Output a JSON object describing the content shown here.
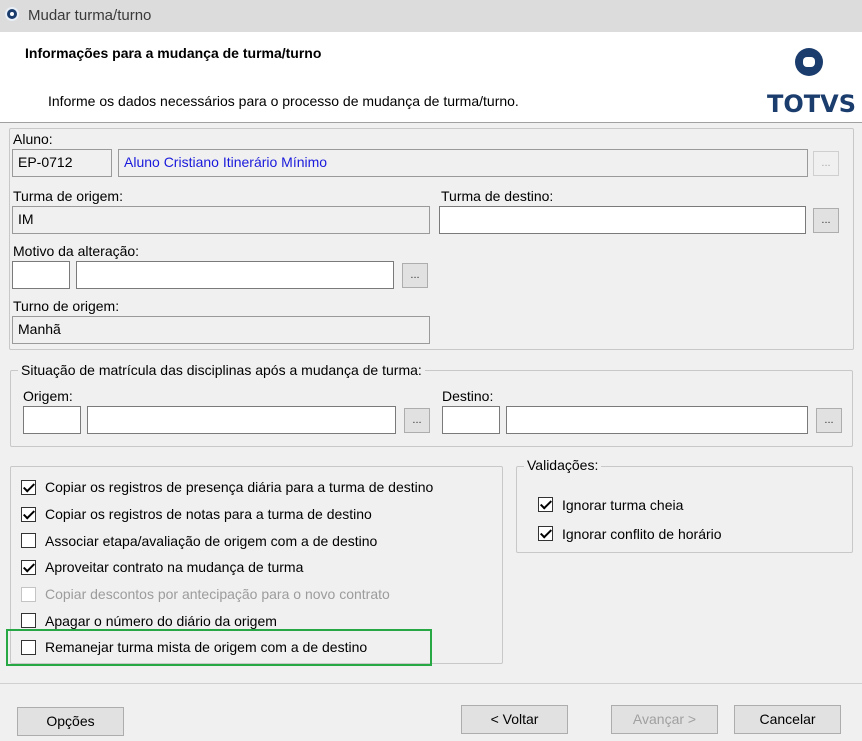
{
  "window": {
    "title": "Mudar turma/turno"
  },
  "header": {
    "title": "Informações para a mudança de turma/turno",
    "subtitle": "Informe os dados necessários para o processo de mudança de turma/turno.",
    "logo_text": "TOTVS",
    "logo_color": "#1b3d6d"
  },
  "aluno": {
    "label": "Aluno:",
    "code": "EP-0712",
    "name": "Aluno Cristiano Itinerário Mínimo",
    "lookup": "..."
  },
  "turma_origem": {
    "label": "Turma de origem:",
    "value": "IM"
  },
  "turma_destino": {
    "label": "Turma de destino:",
    "value": "",
    "lookup": "..."
  },
  "motivo": {
    "label": "Motivo da alteração:",
    "code": "",
    "desc": "",
    "lookup": "..."
  },
  "turno_origem": {
    "label": "Turno de origem:",
    "value": "Manhã"
  },
  "situacao": {
    "legend": "Situação de matrícula das disciplinas após a mudança de turma:",
    "origem_label": "Origem:",
    "destino_label": "Destino:",
    "lookup": "..."
  },
  "options": [
    {
      "label": "Copiar os registros de presença diária para a turma de destino",
      "checked": true,
      "disabled": false
    },
    {
      "label": "Copiar os registros de notas para a turma de destino",
      "checked": true,
      "disabled": false
    },
    {
      "label": "Associar etapa/avaliação de origem com a de destino",
      "checked": false,
      "disabled": false
    },
    {
      "label": "Aproveitar contrato na mudança de turma",
      "checked": true,
      "disabled": false
    },
    {
      "label": "Copiar descontos por antecipação para o novo contrato",
      "checked": false,
      "disabled": true
    },
    {
      "label": "Apagar o número do diário da origem",
      "checked": false,
      "disabled": false
    },
    {
      "label": "Remanejar turma mista de origem com a de destino",
      "checked": false,
      "disabled": false
    }
  ],
  "validacoes": {
    "legend": "Validações:",
    "items": [
      {
        "label": "Ignorar turma cheia",
        "checked": true
      },
      {
        "label": "Ignorar conflito de horário",
        "checked": true
      }
    ]
  },
  "footer": {
    "options_label": "Opções",
    "back_label": "< Voltar",
    "next_label": "Avançar >",
    "cancel_label": "Cancelar"
  },
  "colors": {
    "highlight": "#27a844",
    "link": "#1a1adc"
  }
}
